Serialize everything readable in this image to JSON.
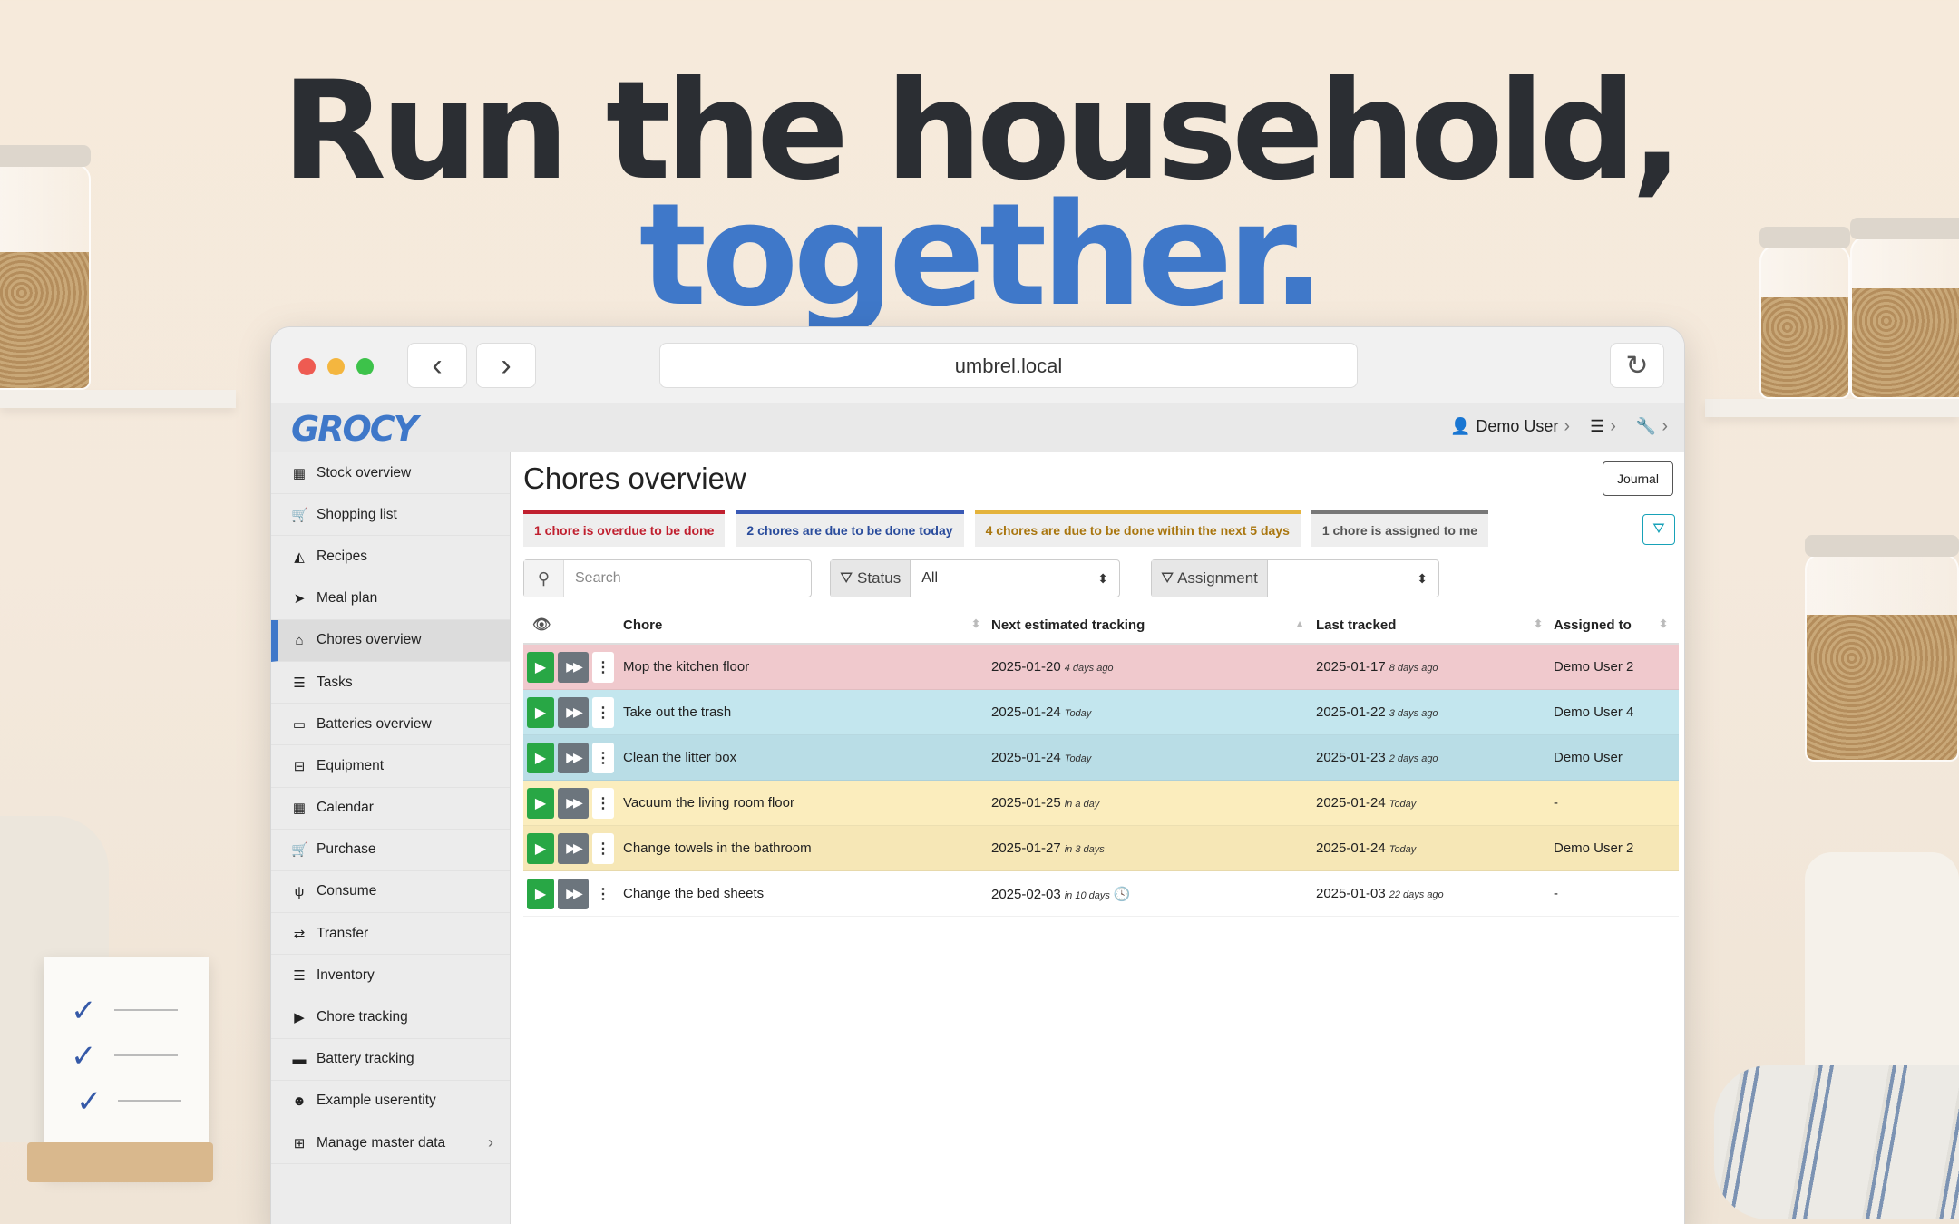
{
  "hero": {
    "line1": "Run the household,",
    "line2": "together."
  },
  "browser": {
    "url": "umbrel.local"
  },
  "app": {
    "logo": "GROCY",
    "user": "Demo User",
    "sidebar": [
      {
        "label": "Stock overview",
        "icon": "box-icon"
      },
      {
        "label": "Shopping list",
        "icon": "cart-icon"
      },
      {
        "label": "Recipes",
        "icon": "pizza-icon"
      },
      {
        "label": "Meal plan",
        "icon": "paper-plane-icon"
      },
      {
        "label": "Chores overview",
        "icon": "home-icon",
        "active": true
      },
      {
        "label": "Tasks",
        "icon": "tasks-icon"
      },
      {
        "label": "Batteries overview",
        "icon": "battery-icon"
      },
      {
        "label": "Equipment",
        "icon": "toolbox-icon"
      },
      {
        "label": "Calendar",
        "icon": "calendar-icon"
      },
      {
        "label": "Purchase",
        "icon": "cart-plus-icon"
      },
      {
        "label": "Consume",
        "icon": "utensils-icon"
      },
      {
        "label": "Transfer",
        "icon": "exchange-icon"
      },
      {
        "label": "Inventory",
        "icon": "list-icon"
      },
      {
        "label": "Chore tracking",
        "icon": "play-icon"
      },
      {
        "label": "Battery tracking",
        "icon": "car-battery-icon"
      },
      {
        "label": "Example userentity",
        "icon": "smile-icon"
      },
      {
        "label": "Manage master data",
        "icon": "table-icon"
      }
    ],
    "page_title": "Chores overview",
    "journal_label": "Journal",
    "badges": [
      {
        "text": "1 chore is overdue to be done",
        "color": "#c0202f",
        "bar": "#c0202f"
      },
      {
        "text": "2 chores are due to be done today",
        "color": "#2a4c9c",
        "bar": "#3959b5"
      },
      {
        "text": "4 chores are due to be done within the next 5 days",
        "color": "#a9760f",
        "bar": "#e4b33c"
      },
      {
        "text": "1 chore is assigned to me",
        "color": "#555555",
        "bar": "#777777"
      }
    ],
    "search_placeholder": "Search",
    "status_label": "Status",
    "status_value": "All",
    "assignment_label": "Assignment",
    "assignment_value": "",
    "columns": [
      "Chore",
      "Next estimated tracking",
      "Last tracked",
      "Assigned to"
    ],
    "rows": [
      {
        "chore": "Mop the kitchen floor",
        "next": "2025-01-20",
        "next_rel": "4 days ago",
        "last": "2025-01-17",
        "last_rel": "8 days ago",
        "assigned": "Demo User 2",
        "style": "r-red"
      },
      {
        "chore": "Take out the trash",
        "next": "2025-01-24",
        "next_rel": "Today",
        "last": "2025-01-22",
        "last_rel": "3 days ago",
        "assigned": "Demo User 4",
        "style": "r-blue"
      },
      {
        "chore": "Clean the litter box",
        "next": "2025-01-24",
        "next_rel": "Today",
        "last": "2025-01-23",
        "last_rel": "2 days ago",
        "assigned": "Demo User",
        "style": "r-blue2"
      },
      {
        "chore": "Vacuum the living room floor",
        "next": "2025-01-25",
        "next_rel": "in a day",
        "last": "2025-01-24",
        "last_rel": "Today",
        "assigned": "-",
        "style": "r-yel"
      },
      {
        "chore": "Change towels in the bathroom",
        "next": "2025-01-27",
        "next_rel": "in 3 days",
        "last": "2025-01-24",
        "last_rel": "Today",
        "assigned": "Demo User 2",
        "style": "r-yel2"
      },
      {
        "chore": "Change the bed sheets",
        "next": "2025-02-03",
        "next_rel": "in 10 days",
        "last": "2025-01-03",
        "last_rel": "22 days ago",
        "assigned": "-",
        "style": "r-white",
        "clock": true
      }
    ]
  }
}
